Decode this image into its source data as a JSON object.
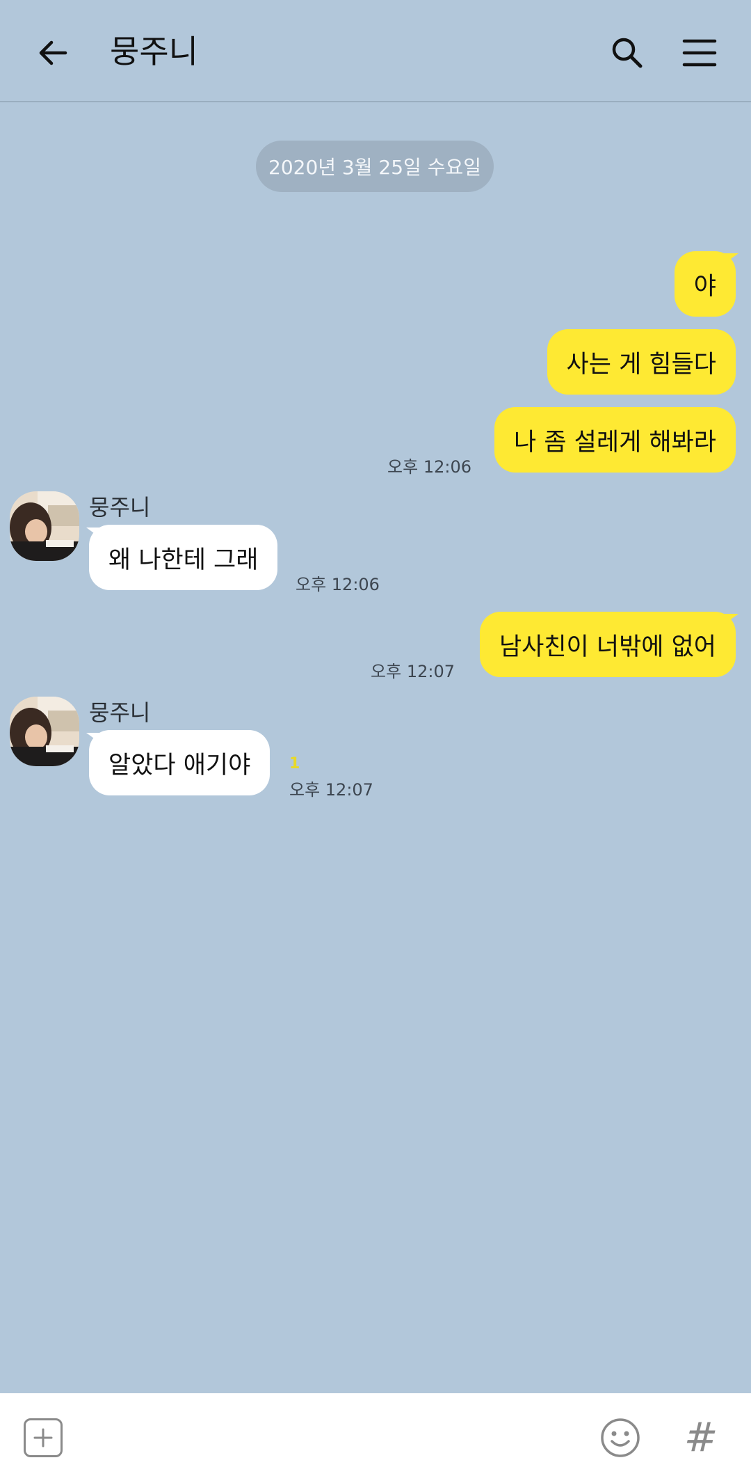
{
  "header": {
    "title": "뭉주니",
    "back_icon": "arrow-left-icon",
    "search_icon": "search-icon",
    "menu_icon": "hamburger-menu-icon"
  },
  "date_divider": "2020년 3월 25일 수요일",
  "messages": [
    {
      "from": "me",
      "text": "야"
    },
    {
      "from": "me",
      "text": "사는 게 힘들다"
    },
    {
      "from": "me",
      "text": "나 좀 설레게 해봐라",
      "time": "오후 12:06"
    },
    {
      "from": "them",
      "sender": "뭉주니",
      "text": "왜 나한테 그래",
      "time": "오후 12:06"
    },
    {
      "from": "me",
      "text": "남사친이 너밖에 없어",
      "time": "오후 12:07"
    },
    {
      "from": "them",
      "sender": "뭉주니",
      "text": "알았다 애기야",
      "time": "오후 12:07",
      "unread": "1"
    }
  ],
  "input_bar": {
    "plus_icon": "plus-icon",
    "emoji_icon": "emoji-icon",
    "hashtag_icon": "#"
  },
  "colors": {
    "background": "#b2c7da",
    "my_bubble": "#fee933",
    "their_bubble": "#ffffff",
    "unread": "#e8d927"
  }
}
